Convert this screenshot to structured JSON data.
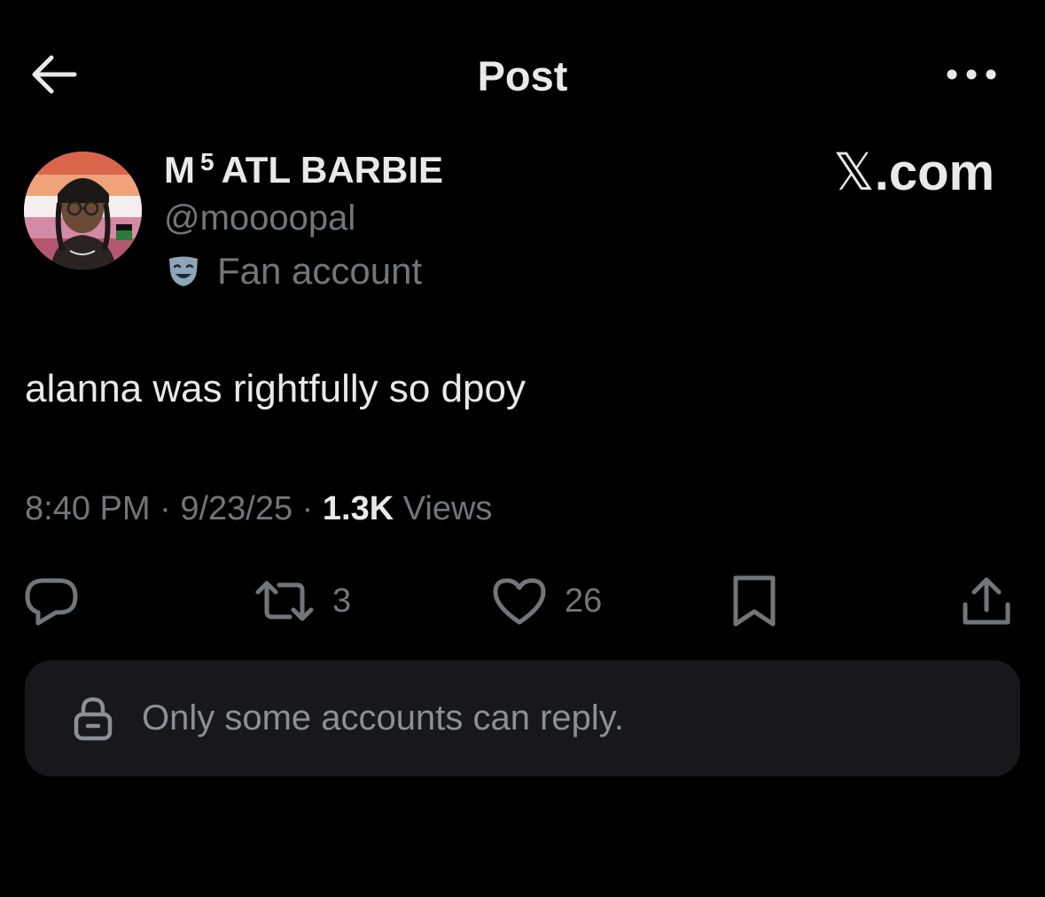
{
  "header": {
    "title": "Post",
    "back_icon": "arrow-left-icon",
    "more_icon": "more-horizontal-icon"
  },
  "author": {
    "display_name_prefix": "M",
    "display_name_sup": "5",
    "display_name_suffix": "ATL BARBIE",
    "handle": "@moooopal",
    "label_icon": "theater-masks-icon",
    "label": "Fan account"
  },
  "brand": {
    "x_glyph": "𝕏",
    "suffix": ".com"
  },
  "post": {
    "text": "alanna was rightfully so dpoy",
    "time": "8:40 PM",
    "date": "9/23/25",
    "separator": "·",
    "views_count": "1.3K",
    "views_label": "Views"
  },
  "actions": {
    "reply_icon": "reply-icon",
    "repost_icon": "repost-icon",
    "repost_count": "3",
    "like_icon": "heart-icon",
    "like_count": "26",
    "bookmark_icon": "bookmark-icon",
    "share_icon": "share-icon"
  },
  "reply_restriction": {
    "icon": "lock-icon",
    "text": "Only some accounts can reply."
  },
  "colors": {
    "background": "#000000",
    "primary_text": "#e7e9ea",
    "secondary_text": "#71767b",
    "reply_bar_bg": "#16181c"
  }
}
